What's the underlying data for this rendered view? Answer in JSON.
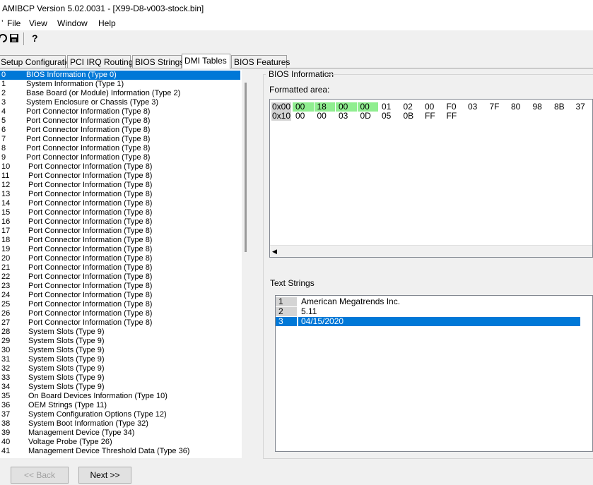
{
  "window": {
    "title": "AMIBCP Version 5.02.0031 - [X99-D8-v003-stock.bin]"
  },
  "menu": [
    "File",
    "View",
    "Window",
    "Help"
  ],
  "toolbar": {
    "items": [
      "open-icon",
      "save-icon",
      "help-icon"
    ]
  },
  "tabs": [
    "Setup Configuration",
    "PCI IRQ Routing",
    "BIOS Strings",
    "DMI Tables",
    "BIOS Features"
  ],
  "active_tab": "DMI Tables",
  "tree": {
    "selected_index": 0,
    "items": [
      {
        "num": "0",
        "label": "BIOS Information  (Type 0)"
      },
      {
        "num": "1",
        "label": "System Information  (Type 1)"
      },
      {
        "num": "2",
        "label": "Base Board (or Module) Information  (Type 2)"
      },
      {
        "num": "3",
        "label": "System Enclosure or Chassis  (Type 3)"
      },
      {
        "num": "4",
        "label": "Port Connector Information  (Type 8)"
      },
      {
        "num": "5",
        "label": "Port Connector Information  (Type 8)"
      },
      {
        "num": "6",
        "label": "Port Connector Information  (Type 8)"
      },
      {
        "num": "7",
        "label": "Port Connector Information  (Type 8)"
      },
      {
        "num": "8",
        "label": "Port Connector Information  (Type 8)"
      },
      {
        "num": "9",
        "label": "Port Connector Information  (Type 8)"
      },
      {
        "num": "10",
        "label": "Port Connector Information  (Type 8)"
      },
      {
        "num": "11",
        "label": "Port Connector Information  (Type 8)"
      },
      {
        "num": "12",
        "label": "Port Connector Information  (Type 8)"
      },
      {
        "num": "13",
        "label": "Port Connector Information  (Type 8)"
      },
      {
        "num": "14",
        "label": "Port Connector Information  (Type 8)"
      },
      {
        "num": "15",
        "label": "Port Connector Information  (Type 8)"
      },
      {
        "num": "16",
        "label": "Port Connector Information  (Type 8)"
      },
      {
        "num": "17",
        "label": "Port Connector Information  (Type 8)"
      },
      {
        "num": "18",
        "label": "Port Connector Information  (Type 8)"
      },
      {
        "num": "19",
        "label": "Port Connector Information  (Type 8)"
      },
      {
        "num": "20",
        "label": "Port Connector Information  (Type 8)"
      },
      {
        "num": "21",
        "label": "Port Connector Information  (Type 8)"
      },
      {
        "num": "22",
        "label": "Port Connector Information  (Type 8)"
      },
      {
        "num": "23",
        "label": "Port Connector Information  (Type 8)"
      },
      {
        "num": "24",
        "label": "Port Connector Information  (Type 8)"
      },
      {
        "num": "25",
        "label": "Port Connector Information  (Type 8)"
      },
      {
        "num": "26",
        "label": "Port Connector Information  (Type 8)"
      },
      {
        "num": "27",
        "label": "Port Connector Information  (Type 8)"
      },
      {
        "num": "28",
        "label": "System Slots  (Type 9)"
      },
      {
        "num": "29",
        "label": "System Slots  (Type 9)"
      },
      {
        "num": "30",
        "label": "System Slots  (Type 9)"
      },
      {
        "num": "31",
        "label": "System Slots  (Type 9)"
      },
      {
        "num": "32",
        "label": "System Slots  (Type 9)"
      },
      {
        "num": "33",
        "label": "System Slots  (Type 9)"
      },
      {
        "num": "34",
        "label": "System Slots  (Type 9)"
      },
      {
        "num": "35",
        "label": "On Board Devices Information  (Type 10)"
      },
      {
        "num": "36",
        "label": "OEM Strings  (Type 11)"
      },
      {
        "num": "37",
        "label": "System Configuration Options  (Type 12)"
      },
      {
        "num": "38",
        "label": "System Boot Information  (Type 32)"
      },
      {
        "num": "39",
        "label": "Management Device  (Type 34)"
      },
      {
        "num": "40",
        "label": "Voltage Probe  (Type 26)"
      },
      {
        "num": "41",
        "label": "Management Device Threshold Data  (Type 36)"
      }
    ]
  },
  "bios_info": {
    "group_title": "BIOS Information",
    "formatted_label": "Formatted area:",
    "rows": [
      {
        "offset": "0x00",
        "bytes": [
          "00",
          "18",
          "00",
          "00",
          "01",
          "02",
          "00",
          "F0",
          "03",
          "7F",
          "80",
          "98",
          "8B",
          "37"
        ],
        "highlighted": [
          0,
          1,
          2,
          3
        ]
      },
      {
        "offset": "0x10",
        "bytes": [
          "00",
          "00",
          "03",
          "0D",
          "05",
          "0B",
          "FF",
          "FF"
        ],
        "highlighted": []
      }
    ]
  },
  "text_strings": {
    "label": "Text Strings",
    "selected_index": 2,
    "items": [
      {
        "num": "1",
        "value": "American Megatrends Inc."
      },
      {
        "num": "2",
        "value": "5.11"
      },
      {
        "num": "3",
        "value": "04/15/2020"
      }
    ]
  },
  "buttons": {
    "back": "<< Back",
    "next": "Next >>"
  }
}
